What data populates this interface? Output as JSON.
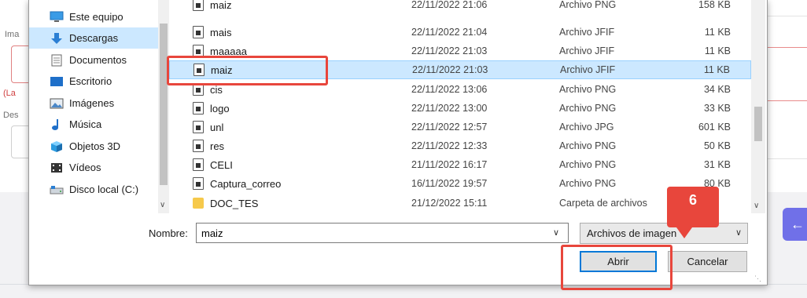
{
  "background": {
    "labels": [
      "Ima",
      "(La",
      "Des"
    ],
    "back_arrow": "←"
  },
  "nav": {
    "items": [
      {
        "label": "Este equipo",
        "icon": "monitor-icon"
      },
      {
        "label": "Descargas",
        "icon": "download-arrow-icon"
      },
      {
        "label": "Documentos",
        "icon": "document-icon"
      },
      {
        "label": "Escritorio",
        "icon": "desktop-icon"
      },
      {
        "label": "Imágenes",
        "icon": "images-icon"
      },
      {
        "label": "Música",
        "icon": "music-note-icon"
      },
      {
        "label": "Objetos 3D",
        "icon": "cube-icon"
      },
      {
        "label": "Vídeos",
        "icon": "video-icon"
      },
      {
        "label": "Disco local (C:)",
        "icon": "disk-icon"
      }
    ],
    "selected_index": 1
  },
  "files": [
    {
      "name": "maiz",
      "date": "22/11/2022 21:06",
      "type": "Archivo PNG",
      "size": "158 KB"
    },
    {
      "name": "mais",
      "date": "22/11/2022 21:04",
      "type": "Archivo JFIF",
      "size": "11 KB"
    },
    {
      "name": "maaaaa",
      "date": "22/11/2022 21:03",
      "type": "Archivo JFIF",
      "size": "11 KB"
    },
    {
      "name": "maiz",
      "date": "22/11/2022 21:03",
      "type": "Archivo JFIF",
      "size": "11 KB"
    },
    {
      "name": "cis",
      "date": "22/11/2022 13:06",
      "type": "Archivo PNG",
      "size": "34 KB"
    },
    {
      "name": "logo",
      "date": "22/11/2022 13:00",
      "type": "Archivo PNG",
      "size": "33 KB"
    },
    {
      "name": "unl",
      "date": "22/11/2022 12:57",
      "type": "Archivo JPG",
      "size": "601 KB"
    },
    {
      "name": "res",
      "date": "22/11/2022 12:33",
      "type": "Archivo PNG",
      "size": "50 KB"
    },
    {
      "name": "CELI",
      "date": "21/11/2022 16:17",
      "type": "Archivo PNG",
      "size": "31 KB"
    },
    {
      "name": "Captura_correo",
      "date": "16/11/2022 19:57",
      "type": "Archivo PNG",
      "size": "80 KB"
    },
    {
      "name": "DOC_TES",
      "date": "21/12/2022 15:11",
      "type": "Carpeta de archivos",
      "size": ""
    }
  ],
  "selected_file_index": 3,
  "filename": {
    "label": "Nombre:",
    "value": "maiz"
  },
  "filter": {
    "selected": "Archivos de imagen"
  },
  "buttons": {
    "open": "Abrir",
    "cancel": "Cancelar"
  },
  "annotation": {
    "step_number": "6"
  },
  "colors": {
    "selection": "#cce8ff",
    "highlight": "#e8463c",
    "accent": "#0078d7"
  }
}
